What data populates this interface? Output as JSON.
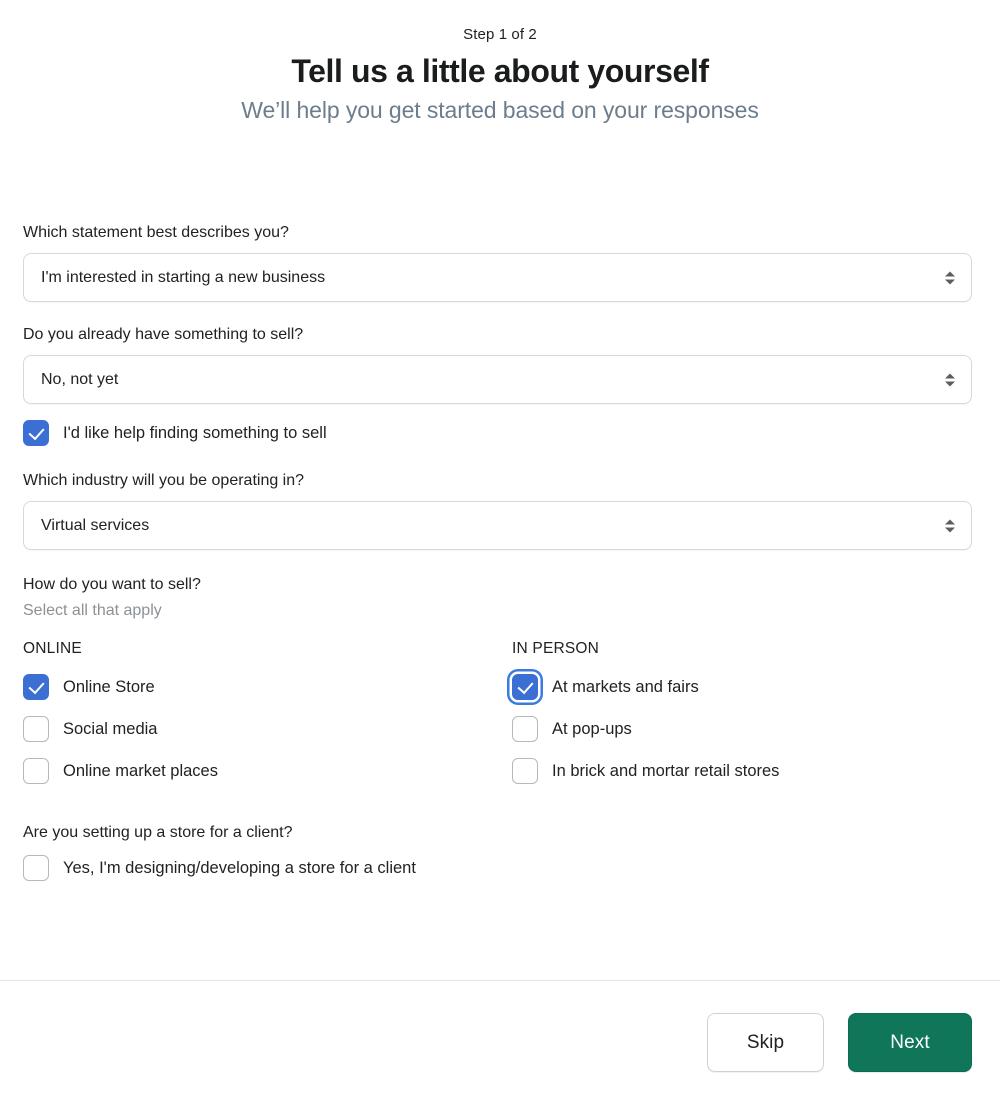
{
  "header": {
    "step_label": "Step 1 of 2",
    "title": "Tell us a little about yourself",
    "subtitle": "We’ll help you get started based on your responses"
  },
  "questions": {
    "statement": {
      "label": "Which statement best describes you?",
      "value": "I'm interested in starting a new business",
      "icon": "stepper-arrows-icon"
    },
    "something_to_sell": {
      "label": "Do you already have something to sell?",
      "value": "No, not yet",
      "icon": "stepper-arrows-icon",
      "help_checkbox": {
        "label": "I'd like help finding something to sell",
        "checked": true
      }
    },
    "industry": {
      "label": "Which industry will you be operating in?",
      "value": "Virtual services",
      "icon": "stepper-arrows-icon"
    },
    "how_to_sell": {
      "heading": "How do you want to sell?",
      "sub": "Select all that apply",
      "columns": [
        {
          "title": "ONLINE",
          "options": [
            {
              "label": "Online Store",
              "checked": true,
              "focused": false
            },
            {
              "label": "Social media",
              "checked": false,
              "focused": false
            },
            {
              "label": "Online market places",
              "checked": false,
              "focused": false
            }
          ]
        },
        {
          "title": "IN PERSON",
          "options": [
            {
              "label": "At markets and fairs",
              "checked": true,
              "focused": true
            },
            {
              "label": "At pop-ups",
              "checked": false,
              "focused": false
            },
            {
              "label": "In brick and mortar retail stores",
              "checked": false,
              "focused": false
            }
          ]
        }
      ]
    },
    "client_store": {
      "label": "Are you setting up a store for a client?",
      "checkbox": {
        "label": "Yes, I'm designing/developing a store for a client",
        "checked": false
      }
    }
  },
  "footer": {
    "skip_label": "Skip",
    "next_label": "Next"
  },
  "colors": {
    "checkbox_checked": "#3b6fd4",
    "focus_ring": "#3b7ae0",
    "primary_button": "#10765a",
    "subtitle": "#6d7d8d",
    "muted_text": "#8c9196",
    "border": "#d6d9dc"
  }
}
